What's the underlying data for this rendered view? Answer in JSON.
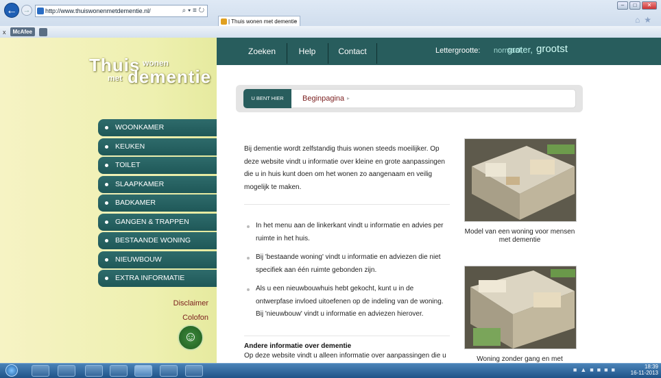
{
  "browser": {
    "url": "http://www.thuiswonenmetdementie.nl/",
    "search_tools": "⌕ ▾ ≡ ↻",
    "tab_title": "| Thuis wonen met dementie",
    "tab_close": "×",
    "toolbar_close": "x",
    "toolbar_mcafee": "McAfee",
    "window_buttons": [
      "–",
      "□",
      "✕"
    ]
  },
  "logo": {
    "thuis": "Thuis",
    "wonen": "wonen",
    "met": "met",
    "dementie": "dementie"
  },
  "menu": {
    "items": [
      "WOONKAMER",
      "KEUKEN",
      "TOILET",
      "SLAAPKAMER",
      "BADKAMER",
      "GANGEN & TRAPPEN",
      "BESTAANDE WONING",
      "NIEUWBOUW",
      "EXTRA INFORMATIE"
    ]
  },
  "footer_links": {
    "disclaimer": "Disclaimer",
    "colofon": "Colofon"
  },
  "topnav": {
    "zoeken": "Zoeken",
    "help": "Help",
    "contact": "Contact",
    "lettergrootte": "Lettergrootte:",
    "normaal": "normaal,",
    "groter": "groter,",
    "grootst": "grootst"
  },
  "breadcrumb": {
    "label": "U BENT HIER",
    "current": "Beginpagina",
    "arrow": "▸"
  },
  "content": {
    "intro": "Bij dementie wordt zelfstandig thuis wonen steeds moeilijker. Op deze website vindt u informatie over kleine en grote aanpassingen die u in huis kunt doen om het wonen zo aangenaam en veilig mogelijk te maken.",
    "bullets": [
      "In het menu aan de linkerkant vindt u informatie en advies per ruimte in het huis.",
      "Bij 'bestaande woning' vindt u informatie en adviezen die niet specifiek aan één ruimte gebonden zijn.",
      "Als u een nieuwbouwhuis hebt gekocht, kunt u in de ontwerpfase invloed uitoefenen op de indeling van de woning. Bij 'nieuwbouw' vindt u informatie en adviezen hierover."
    ],
    "andere_title": "Andere informatie over dementie",
    "andere_text": "Op deze website vindt u alleen informatie over aanpassingen die u"
  },
  "images": [
    {
      "caption": "Model van een woning voor mensen met dementie"
    },
    {
      "caption": "Woning zonder gang en met"
    }
  ],
  "taskbar": {
    "time": "18:39",
    "date": "16-11-2013"
  },
  "colors": {
    "teal": "#285d5d",
    "maroon": "#7a1d1d",
    "sidebar": "#eef0b0"
  }
}
